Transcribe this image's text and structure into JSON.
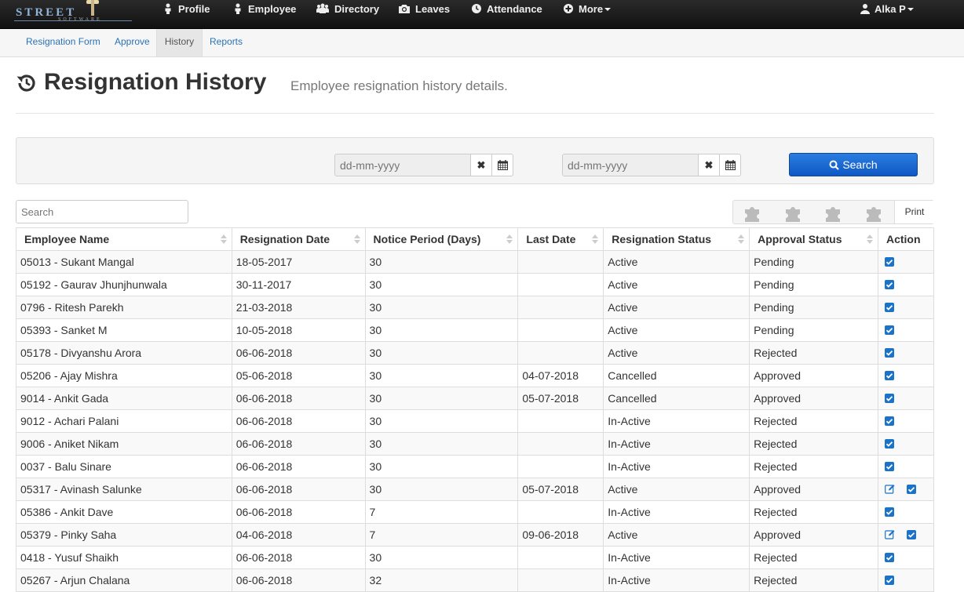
{
  "logo": {
    "brand": "STREET",
    "sub": "SOFTWARE"
  },
  "topnav": {
    "items": [
      {
        "label": "Profile",
        "icon": "person-icon"
      },
      {
        "label": "Employee",
        "icon": "person-icon"
      },
      {
        "label": "Directory",
        "icon": "group-icon"
      },
      {
        "label": "Leaves",
        "icon": "camera-icon"
      },
      {
        "label": "Attendance",
        "icon": "clock-icon"
      },
      {
        "label": "More",
        "icon": "plus-circle-icon"
      }
    ],
    "user": "Alka P"
  },
  "subnav": {
    "tabs": [
      {
        "label": "Resignation Form"
      },
      {
        "label": "Approve"
      },
      {
        "label": "History"
      },
      {
        "label": "Reports"
      }
    ]
  },
  "header": {
    "title": "Resignation History",
    "subtitle": "Employee resignation history details."
  },
  "filter": {
    "from_placeholder": "dd-mm-yyyy",
    "to_placeholder": "dd-mm-yyyy",
    "search_label": "Search"
  },
  "table_tools": {
    "search_placeholder": "Search",
    "print_label": "Print"
  },
  "table": {
    "columns": [
      "Employee Name",
      "Resignation Date",
      "Notice Period (Days)",
      "Last Date",
      "Resignation Status",
      "Approval Status",
      "Action"
    ],
    "rows": [
      {
        "name": "05013 - Sukant Mangal",
        "date": "18-05-2017",
        "notice": "30",
        "last": "",
        "status": "Active",
        "approval": "Pending",
        "edit": false
      },
      {
        "name": "05192 - Gaurav Jhunjhunwala",
        "date": "30-11-2017",
        "notice": "30",
        "last": "",
        "status": "Active",
        "approval": "Pending",
        "edit": false
      },
      {
        "name": "0796 - Ritesh Parekh",
        "date": "21-03-2018",
        "notice": "30",
        "last": "",
        "status": "Active",
        "approval": "Pending",
        "edit": false
      },
      {
        "name": "05393 - Sanket M",
        "date": "10-05-2018",
        "notice": "30",
        "last": "",
        "status": "Active",
        "approval": "Pending",
        "edit": false
      },
      {
        "name": "05178 - Divyanshu Arora",
        "date": "06-06-2018",
        "notice": "30",
        "last": "",
        "status": "Active",
        "approval": "Rejected",
        "edit": false
      },
      {
        "name": "05206 - Ajay Mishra",
        "date": "05-06-2018",
        "notice": "30",
        "last": "04-07-2018",
        "status": "Cancelled",
        "approval": "Approved",
        "edit": false
      },
      {
        "name": "9014 - Ankit Gada",
        "date": "06-06-2018",
        "notice": "30",
        "last": "05-07-2018",
        "status": "Cancelled",
        "approval": "Approved",
        "edit": false
      },
      {
        "name": "9012 - Achari Palani",
        "date": "06-06-2018",
        "notice": "30",
        "last": "",
        "status": "In-Active",
        "approval": "Rejected",
        "edit": false
      },
      {
        "name": "9006 - Aniket Nikam",
        "date": "06-06-2018",
        "notice": "30",
        "last": "",
        "status": "In-Active",
        "approval": "Rejected",
        "edit": false
      },
      {
        "name": "0037 - Balu Sinare",
        "date": "06-06-2018",
        "notice": "30",
        "last": "",
        "status": "In-Active",
        "approval": "Rejected",
        "edit": false
      },
      {
        "name": "05317 - Avinash Salunke",
        "date": "06-06-2018",
        "notice": "30",
        "last": "05-07-2018",
        "status": "Active",
        "approval": "Approved",
        "edit": true
      },
      {
        "name": "05386 - Ankit Dave",
        "date": "06-06-2018",
        "notice": "7",
        "last": "",
        "status": "In-Active",
        "approval": "Rejected",
        "edit": false
      },
      {
        "name": "05379 - Pinky Saha",
        "date": "04-06-2018",
        "notice": "7",
        "last": "09-06-2018",
        "status": "Active",
        "approval": "Approved",
        "edit": true
      },
      {
        "name": "0418 - Yusuf Shaikh",
        "date": "06-06-2018",
        "notice": "30",
        "last": "",
        "status": "In-Active",
        "approval": "Rejected",
        "edit": false
      },
      {
        "name": "05267 - Arjun Chalana",
        "date": "06-06-2018",
        "notice": "32",
        "last": "",
        "status": "In-Active",
        "approval": "Rejected",
        "edit": false
      }
    ]
  },
  "colors": {
    "accent": "#1d6ed8",
    "link": "#2a72b5",
    "check": "#1a73c8",
    "nav_bg": "#1a1a1a"
  }
}
